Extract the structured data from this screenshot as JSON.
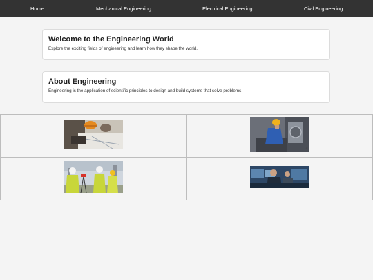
{
  "nav": {
    "items": [
      {
        "label": "Home"
      },
      {
        "label": "Mechanical Engineering"
      },
      {
        "label": "Electrical Engineering"
      },
      {
        "label": "Civil Engineering"
      }
    ]
  },
  "welcome": {
    "title": "Welcome to the Engineering World",
    "text": "Explore the exciting fields of engineering and learn how they shape the world."
  },
  "about": {
    "title": "About Engineering",
    "text": "Engineering is the application of scientific principles to design and build systems that solve problems."
  },
  "gallery": {
    "caret": ">",
    "images": [
      {
        "icon": "engineers-blueprint-photo"
      },
      {
        "icon": "mechanical-worker-photo"
      },
      {
        "icon": "civil-surveyors-photo"
      },
      {
        "icon": "electrical-control-room-photo"
      }
    ]
  },
  "colors": {
    "nav_bg": "#333333",
    "page_bg": "#f4f4f4",
    "card_bg": "#ffffff"
  }
}
